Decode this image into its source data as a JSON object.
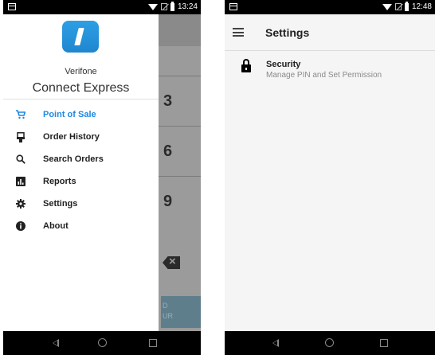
{
  "left_screen": {
    "status_bar": {
      "time": "13:24"
    },
    "drawer": {
      "brand_small": "Verifone",
      "brand_large": "Connect Express",
      "menu": [
        {
          "label": "Point of Sale",
          "icon": "cart-icon",
          "active": true
        },
        {
          "label": "Order History",
          "icon": "receipt-printer-icon",
          "active": false
        },
        {
          "label": "Search Orders",
          "icon": "search-icon",
          "active": false
        },
        {
          "label": "Reports",
          "icon": "bar-chart-icon",
          "active": false
        },
        {
          "label": "Settings",
          "icon": "gear-icon",
          "active": false
        },
        {
          "label": "About",
          "icon": "info-icon",
          "active": false
        }
      ]
    },
    "background_keypad": {
      "keys": [
        "3",
        "6",
        "9"
      ],
      "button_text_line1": "D",
      "button_text_line2": "UR"
    }
  },
  "right_screen": {
    "status_bar": {
      "time": "12:48"
    },
    "app_bar": {
      "title": "Settings"
    },
    "settings": [
      {
        "title": "Security",
        "subtitle": "Manage PIN and Set Permission",
        "icon": "lock-icon"
      }
    ]
  },
  "colors": {
    "accent": "#1e88e5",
    "logo": "#2196f3"
  }
}
